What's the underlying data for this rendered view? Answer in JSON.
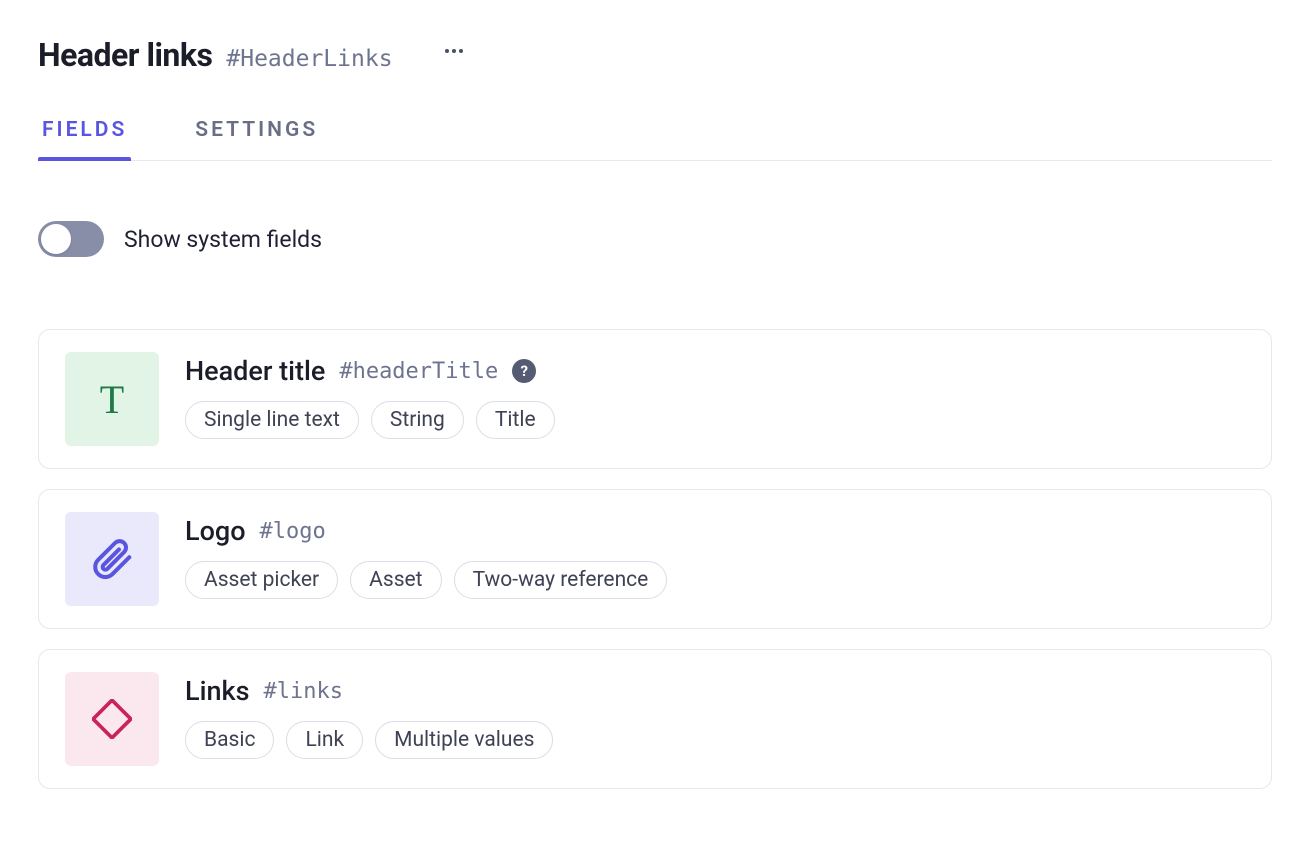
{
  "header": {
    "title": "Header links",
    "id": "#HeaderLinks"
  },
  "tabs": [
    {
      "label": "FIELDS",
      "active": true
    },
    {
      "label": "SETTINGS",
      "active": false
    }
  ],
  "toggle": {
    "label": "Show system fields",
    "on": false
  },
  "fields": [
    {
      "icon_type": "text",
      "icon_glyph": "T",
      "title": "Header title",
      "id": "#headerTitle",
      "help": true,
      "tags": [
        "Single line text",
        "String",
        "Title"
      ]
    },
    {
      "icon_type": "attachment",
      "title": "Logo",
      "id": "#logo",
      "help": false,
      "tags": [
        "Asset picker",
        "Asset",
        "Two-way reference"
      ]
    },
    {
      "icon_type": "link",
      "title": "Links",
      "id": "#links",
      "help": false,
      "tags": [
        "Basic",
        "Link",
        "Multiple values"
      ]
    }
  ]
}
